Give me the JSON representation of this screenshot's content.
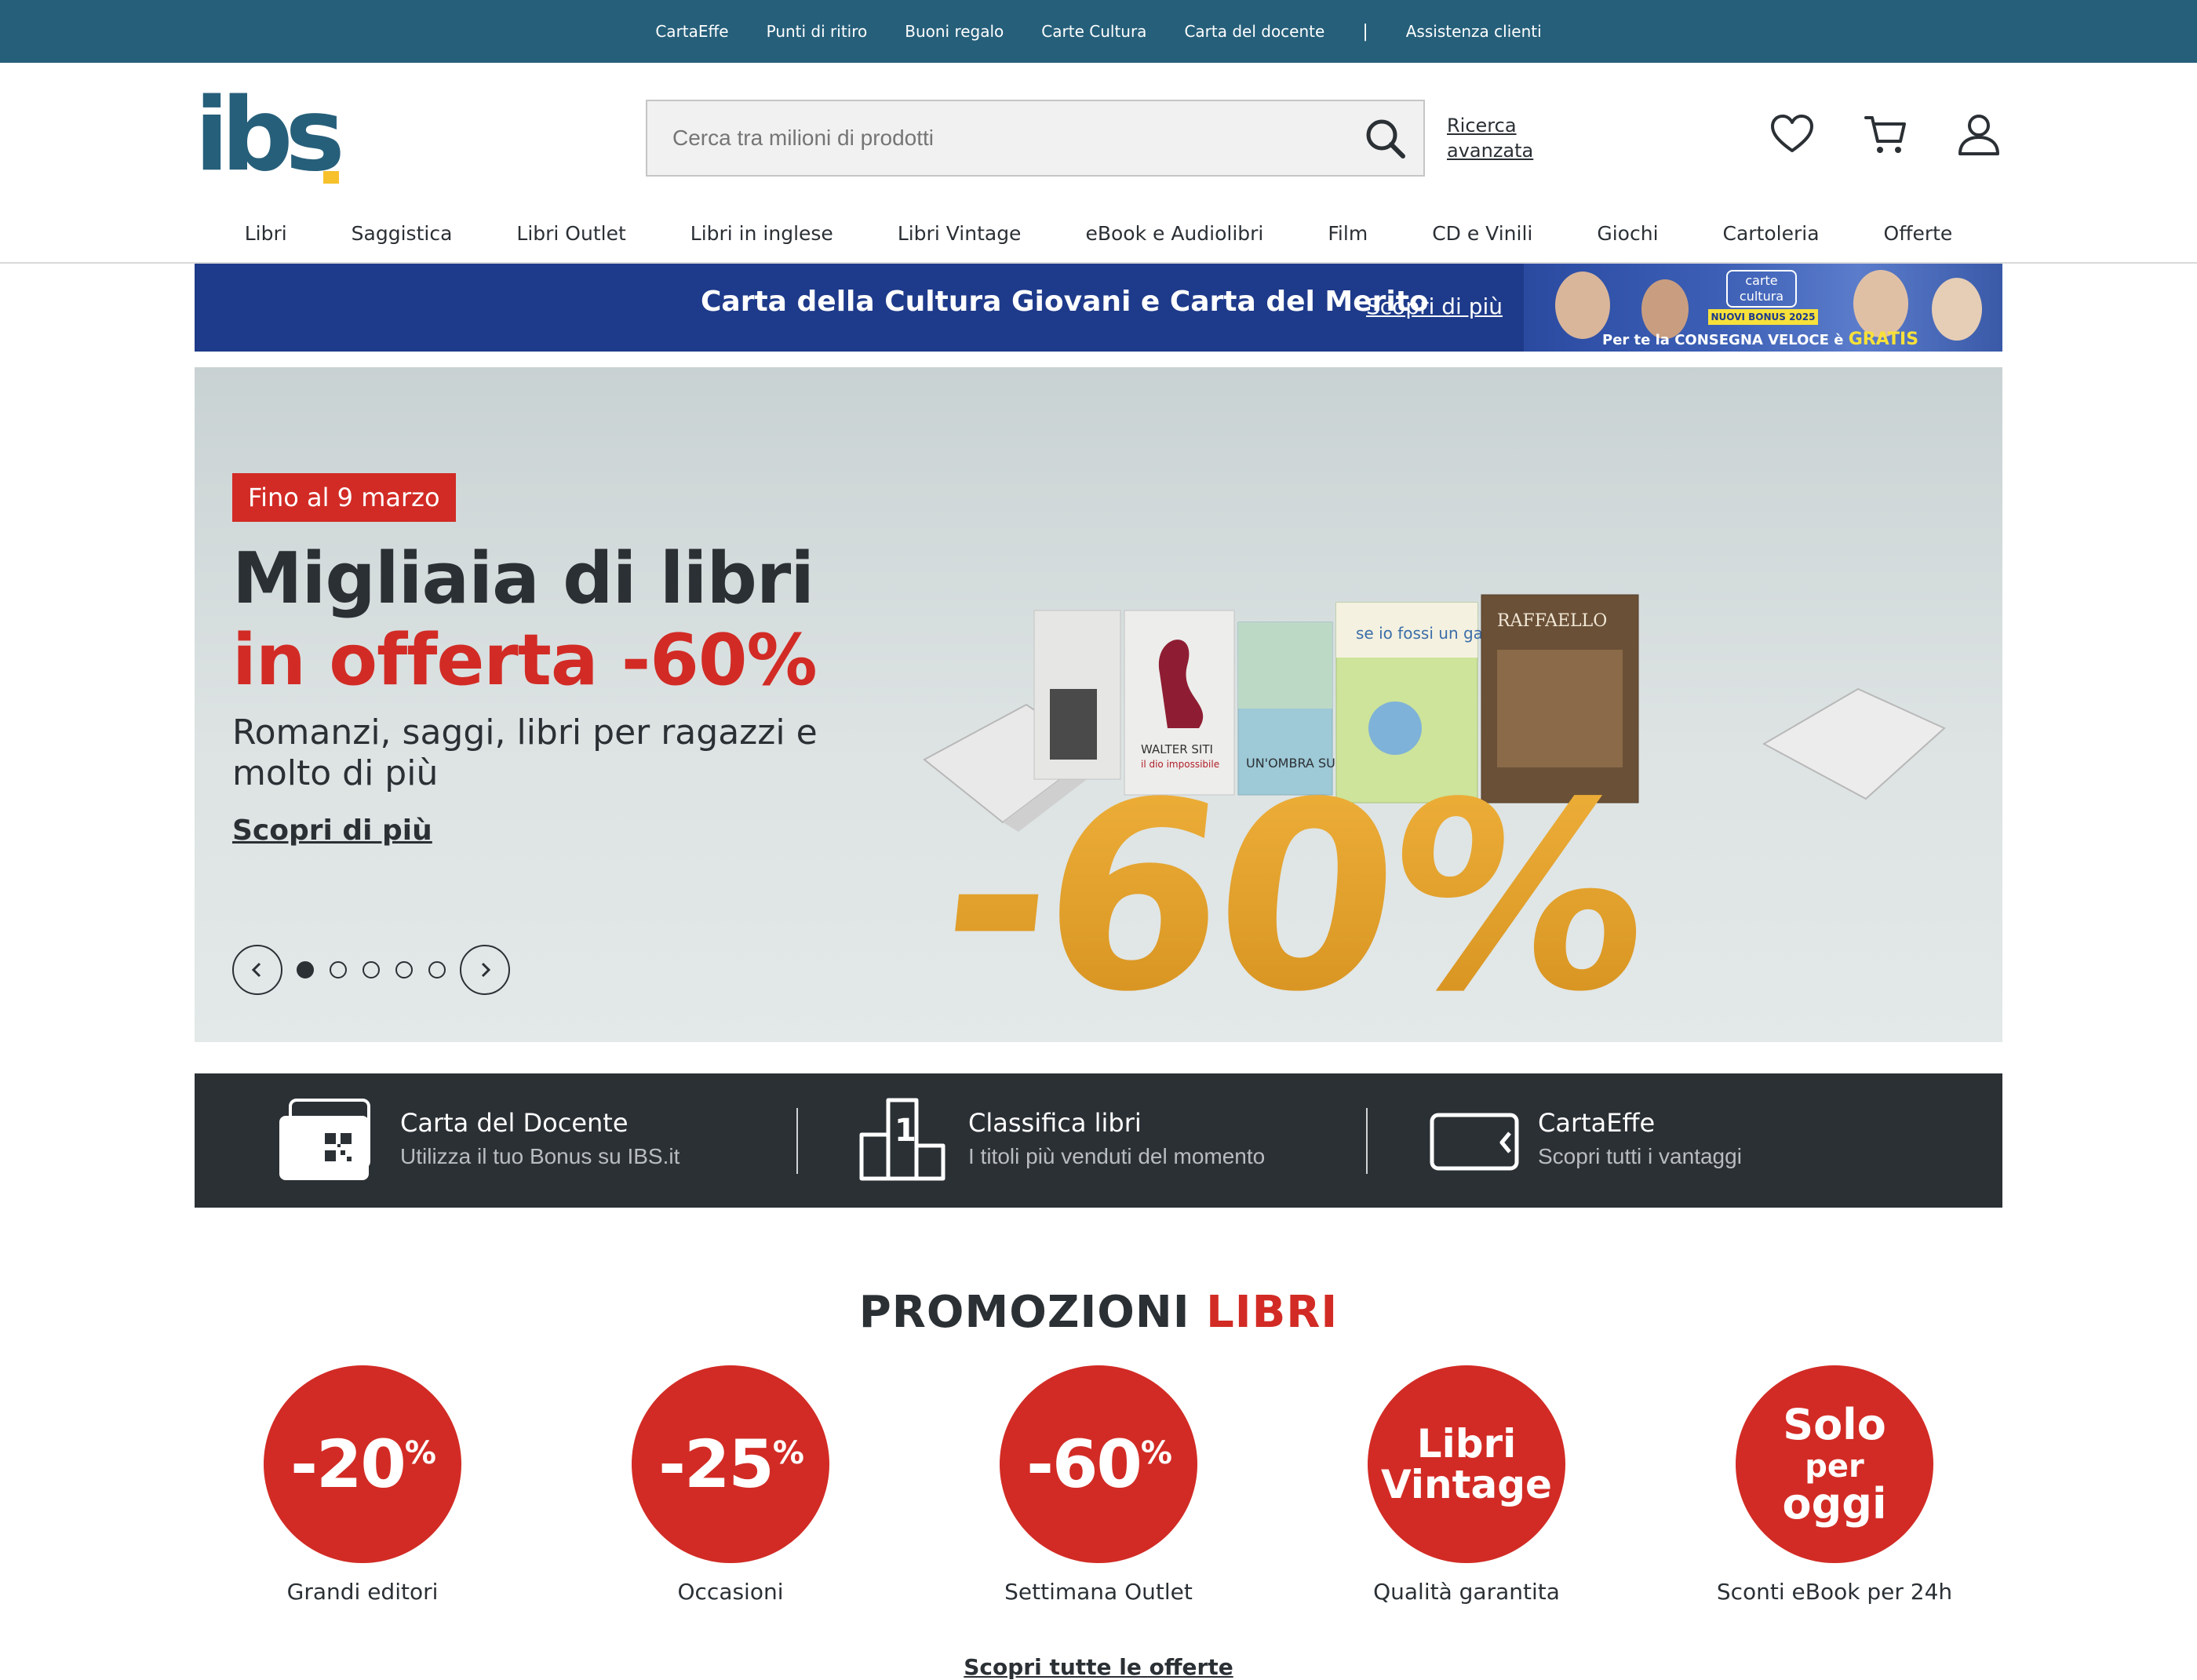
{
  "topbar": {
    "links": [
      "CartaEffe",
      "Punti di ritiro",
      "Buoni regalo",
      "Carte Cultura",
      "Carta del docente"
    ],
    "separator": "|",
    "assistance": "Assistenza clienti"
  },
  "header": {
    "logo_text": "ibs",
    "search_placeholder": "Cerca tra milioni di prodotti",
    "advanced_search_line1": "Ricerca",
    "advanced_search_line2": "avanzata",
    "icons": [
      "heart-icon",
      "cart-icon",
      "user-icon"
    ]
  },
  "nav": {
    "items": [
      "Libri",
      "Saggistica",
      "Libri Outlet",
      "Libri in inglese",
      "Libri Vintage",
      "eBook e Audiolibri",
      "Film",
      "CD e Vinili",
      "Giochi",
      "Cartoleria",
      "Offerte"
    ]
  },
  "strip": {
    "title": "Carta della Cultura Giovani e Carta del Merito",
    "link": "Scopri di più",
    "badge_line1": "carte",
    "badge_line2": "cultura",
    "bonus": "NUOVI BONUS 2025",
    "shipping_prefix": "Per te la CONSEGNA VELOCE è",
    "shipping_free": "GRATIS"
  },
  "hero": {
    "tag": "Fino al 9 marzo",
    "title_line1": "Migliaia di libri",
    "title_line2": "in offerta -60%",
    "subtitle": "Romanzi, saggi, libri per ragazzi e molto di più",
    "cta": "Scopri di più",
    "slides_total": 5,
    "active_slide": 1,
    "art": {
      "big_text": "-60%",
      "book_titles": [
        "WALTER SITI",
        "il dio impossibile",
        "UN'OMBRA SUL LAGO",
        "se io fossi un gatto",
        "RAFFAELLO"
      ]
    }
  },
  "services": [
    {
      "title": "Carta del Docente",
      "subtitle": "Utilizza il tuo Bonus su IBS.it"
    },
    {
      "title": "Classifica libri",
      "subtitle": "I titoli più venduti del momento"
    },
    {
      "title": "CartaEffe",
      "subtitle": "Scopri tutti i vantaggi"
    }
  ],
  "promotions": {
    "title_part1": "PROMOZIONI",
    "title_part2": "LIBRI",
    "items": [
      {
        "badge": "-20",
        "badge_suffix": "%",
        "label": "Grandi editori"
      },
      {
        "badge": "-25",
        "badge_suffix": "%",
        "label": "Occasioni"
      },
      {
        "badge": "-60",
        "badge_suffix": "%",
        "label": "Settimana Outlet"
      },
      {
        "badge_line1": "Libri",
        "badge_line2": "Vintage",
        "label": "Qualità garantita"
      },
      {
        "badge_line1": "Solo",
        "badge_line2": "per",
        "badge_line3": "oggi",
        "label": "Sconti eBook per 24h"
      }
    ],
    "all_link": "Scopri tutte le offerte"
  },
  "colors": {
    "topbar": "#265f7a",
    "accent_red": "#d22b25",
    "dark": "#2b3035",
    "strip_blue": "#1e3a8a",
    "logo_yellow": "#f6c12b"
  }
}
